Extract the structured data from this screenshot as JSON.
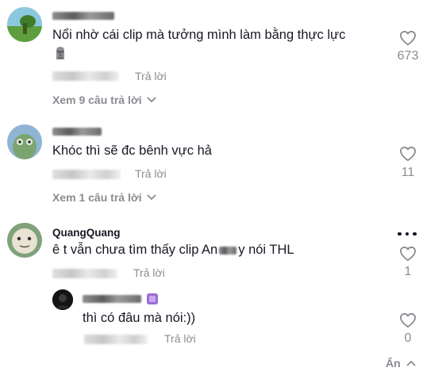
{
  "comments": [
    {
      "username": "Anh B",
      "text": "Nổi nhờ cái clip mà tưởng mình làm bằng thực lực",
      "emoji_icon": "moai-emoji-icon",
      "reply_label": "Trả lời",
      "like_count": "673",
      "view_replies": "Xem 9 câu trả lời"
    },
    {
      "username": "",
      "text": "Khóc thì sẽ đc bênh vực hả",
      "reply_label": "Trả lời",
      "like_count": "11",
      "view_replies": "Xem 1 câu trả lời"
    },
    {
      "username": "QuangQuang",
      "text_before": "ê t vẫn chưa tìm thấy clip An",
      "text_after": "y nói THL",
      "reply_label": "Trả lời",
      "like_count": "1",
      "more_icon": "more-dots-icon",
      "replies": [
        {
          "username": "",
          "text": "thì có đâu mà nói:))",
          "reply_label": "Trả lời",
          "like_count": "0"
        }
      ]
    }
  ],
  "hide_label": "Ẩn",
  "colors": {
    "text": "#161823",
    "muted": "#8a8b91",
    "accent_purple": "#9b6bd6"
  }
}
